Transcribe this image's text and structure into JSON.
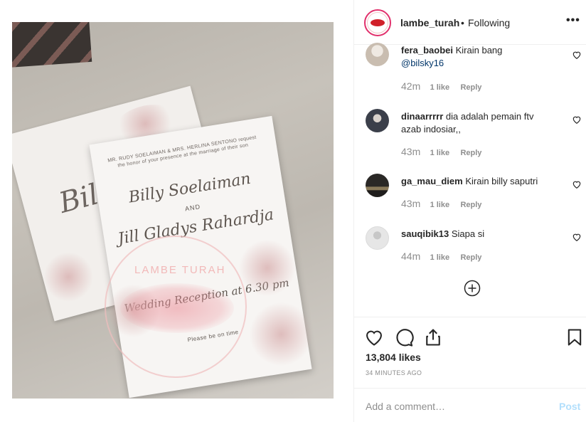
{
  "header": {
    "username": "lambe_turah",
    "separator": "•",
    "follow_status": "Following",
    "more_label": "•••"
  },
  "photo": {
    "invite_top": "MR. RUDY SOELAIMAN & MRS. HERLINA SENTONO request the honor of your presence at the marriage of their son",
    "name1": "Billy Soelaiman",
    "and": "AND",
    "name2": "Jill Gladys Rahardja",
    "reception": "Wedding Reception at 6.30 pm",
    "please": "Please be on time",
    "back_text": "Bil",
    "watermark": "LAMBE TURAH"
  },
  "comments": [
    {
      "username": "fera_baobei",
      "text": "Kirain bang ",
      "mention": "@bilsky16",
      "time": "42m",
      "likes": "1 like",
      "reply": "Reply",
      "avatar_color": "#d9cfc4"
    },
    {
      "username": "dinaarrrrr",
      "text": "dia adalah pemain ftv azab indosiar,,",
      "mention": "",
      "time": "43m",
      "likes": "1 like",
      "reply": "Reply",
      "avatar_color": "#3b3f4a"
    },
    {
      "username": "ga_mau_diem",
      "text": "Kirain billy saputri",
      "mention": "",
      "time": "43m",
      "likes": "1 like",
      "reply": "Reply",
      "avatar_color": "#1f1d1c"
    },
    {
      "username": "sauqibik13",
      "text": "Siapa si",
      "mention": "",
      "time": "44m",
      "likes": "1 like",
      "reply": "Reply",
      "avatar_color": "#e6e6e6"
    }
  ],
  "likes_count": "13,804 likes",
  "posted_time": "34 MINUTES AGO",
  "add_comment": {
    "placeholder": "Add a comment…",
    "post_label": "Post"
  },
  "colors": {
    "link": "#003569",
    "muted": "#8e8e8e",
    "post_disabled": "#b2dffc",
    "brand": "#d0202a"
  }
}
